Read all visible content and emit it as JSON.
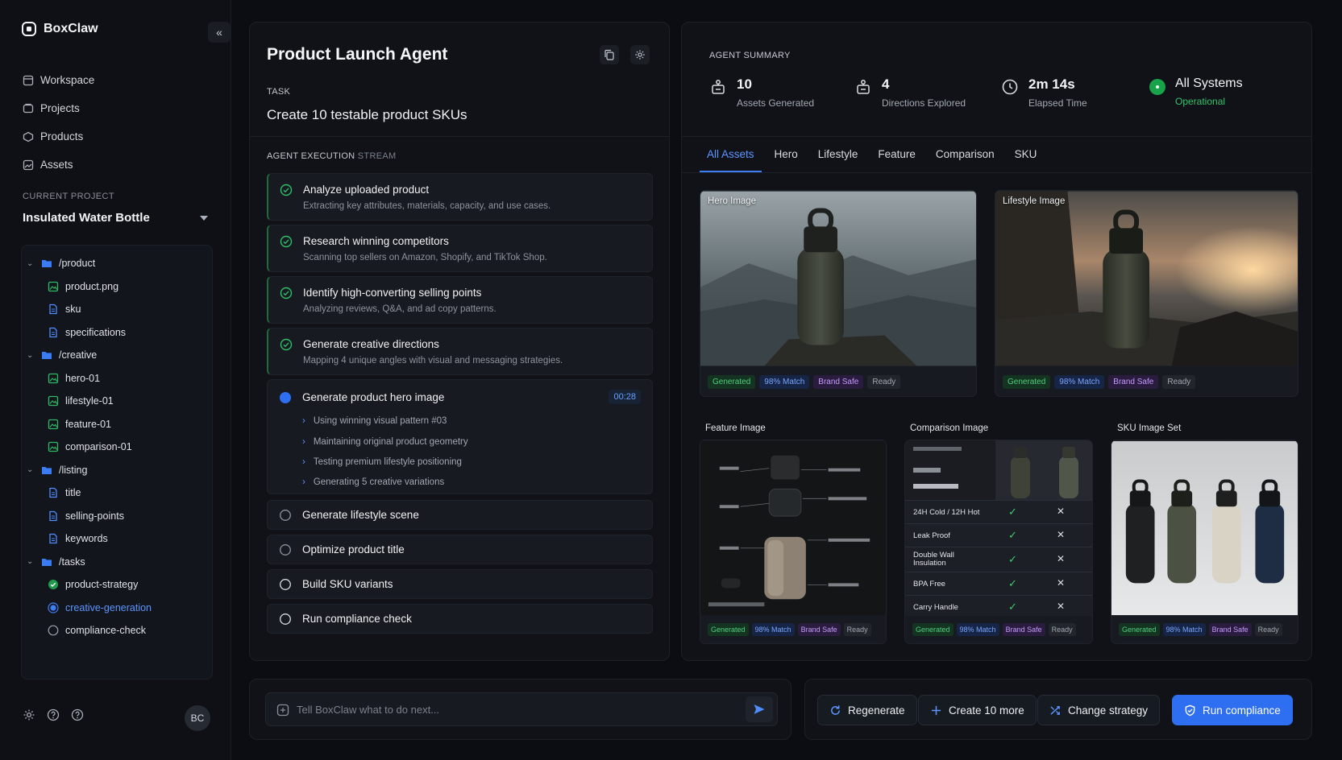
{
  "app": {
    "name": "BoxClaw",
    "collapse_icon": "double-chevron-left-icon"
  },
  "nav": [
    {
      "label": "Workspace",
      "icon": "workspace-icon"
    },
    {
      "label": "Projects",
      "icon": "projects-icon"
    },
    {
      "label": "Products",
      "icon": "products-icon"
    },
    {
      "label": "Assets",
      "icon": "assets-icon"
    }
  ],
  "current_project": {
    "label": "CURRENT PROJECT",
    "name": "Insulated Water Bottle"
  },
  "tree": {
    "product_folder": "/product",
    "product_files": [
      "product.png",
      "sku",
      "specifications"
    ],
    "creative_folder": "/creative",
    "creative_files": [
      "hero-01",
      "lifestyle-01",
      "feature-01",
      "comparison-01"
    ],
    "listing_folder": "/listing",
    "listing_files": [
      "title",
      "selling-points",
      "keywords"
    ],
    "tasks_folder": "/tasks",
    "tasks": [
      {
        "label": "product-strategy",
        "status": "done"
      },
      {
        "label": "creative-generation",
        "status": "active"
      },
      {
        "label": "compliance-check",
        "status": "pending"
      }
    ]
  },
  "user": {
    "initials": "BC"
  },
  "agent": {
    "title": "Product Launch Agent",
    "task_label": "TASK",
    "task": "Create 10 testable product SKUs",
    "stream_label": "AGENT EXECUTION",
    "stream_suffix": "STREAM",
    "steps": [
      {
        "title": "Analyze uploaded product",
        "sub": "Extracting key attributes, materials, capacity, and use cases."
      },
      {
        "title": "Research winning competitors",
        "sub": "Scanning top sellers on Amazon, Shopify, and TikTok Shop."
      },
      {
        "title": "Identify high-converting selling points",
        "sub": "Analyzing reviews, Q&A, and ad copy patterns."
      },
      {
        "title": "Generate creative directions",
        "sub": "Mapping 4 unique angles with visual and messaging strategies."
      }
    ],
    "active_step": {
      "title": "Generate product hero image",
      "time": "00:28",
      "substeps": [
        "Using winning visual pattern #03",
        "Maintaining original product geometry",
        "Testing premium lifestyle positioning",
        "Generating 5 creative variations"
      ]
    },
    "pending_steps": [
      "Generate lifestyle scene",
      "Optimize product title",
      "Build SKU variants",
      "Run compliance check"
    ]
  },
  "summary": {
    "label": "AGENT SUMMARY",
    "stats": [
      {
        "value": "10",
        "label": "Assets Generated"
      },
      {
        "value": "4",
        "label": "Directions Explored"
      },
      {
        "value": "2m 14s",
        "label": "Elapsed Time"
      },
      {
        "value": "All Systems",
        "label": "Operational"
      }
    ]
  },
  "tabs": [
    "All Assets",
    "Hero",
    "Lifestyle",
    "Feature",
    "Comparison",
    "SKU"
  ],
  "badges": {
    "generated": "Generated",
    "match": "98% Match",
    "brand": "Brand Safe",
    "ready": "Ready"
  },
  "assets": {
    "hero": "Hero Image",
    "lifestyle": "Lifestyle Image",
    "feature": "Feature Image",
    "comparison": "Comparison Image",
    "sku": "SKU Image Set"
  },
  "comparison_rows": [
    "24H Cold / 12H Hot",
    "Leak Proof",
    "Double Wall Insulation",
    "BPA Free",
    "Carry Handle"
  ],
  "chat": {
    "placeholder": "Tell BoxClaw what to do next..."
  },
  "actions": {
    "regenerate": "Regenerate",
    "create": "Create 10 more",
    "strategy": "Change strategy",
    "compliance": "Run compliance"
  },
  "colors": {
    "accent": "#2e6ef0",
    "success": "#35c46a",
    "background": "#0b0d12"
  }
}
